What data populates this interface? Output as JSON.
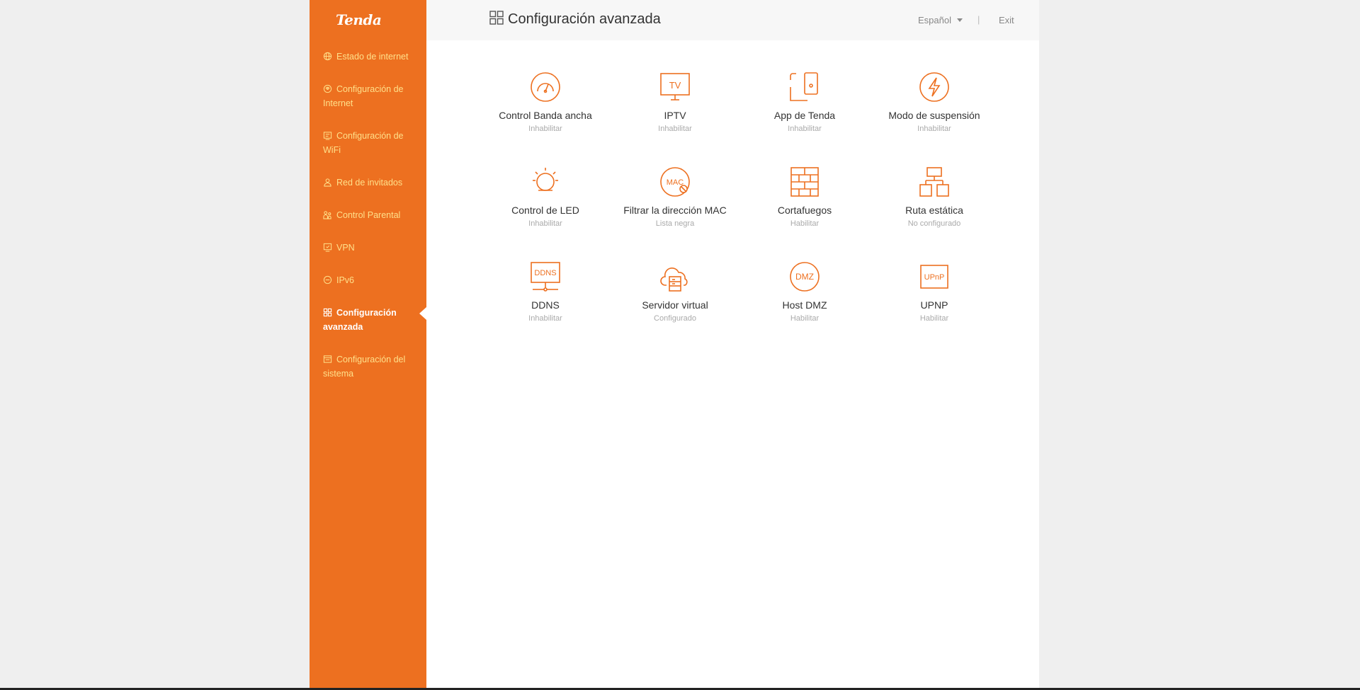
{
  "brand": {
    "logo_text": "Tenda",
    "accent": "#ed7020",
    "nav_text_color": "#ffe08a"
  },
  "sidebar": {
    "items": [
      {
        "label": "Estado de internet",
        "icon": "globe-icon"
      },
      {
        "label": "Configuración de Internet",
        "icon": "internet-settings-icon"
      },
      {
        "label": "Configuración de WiFi",
        "icon": "wifi-settings-icon"
      },
      {
        "label": "Red de invitados",
        "icon": "guest-icon"
      },
      {
        "label": "Control Parental",
        "icon": "parental-icon"
      },
      {
        "label": "VPN",
        "icon": "vpn-icon"
      },
      {
        "label": "IPv6",
        "icon": "ipv6-icon"
      },
      {
        "label": "Configuración avanzada",
        "icon": "grid-icon",
        "active": true
      },
      {
        "label": "Configuración del sistema",
        "icon": "system-icon"
      }
    ]
  },
  "header": {
    "title": "Configuración avanzada",
    "language": "Español",
    "separator": "|",
    "exit_label": "Exit"
  },
  "tiles": [
    {
      "name": "Control Banda ancha",
      "status": "Inhabilitar",
      "icon": "speedometer-icon"
    },
    {
      "name": "IPTV",
      "status": "Inhabilitar",
      "icon": "tv-icon",
      "icon_text": "TV"
    },
    {
      "name": "App de Tenda",
      "status": "Inhabilitar",
      "icon": "app-icon"
    },
    {
      "name": "Modo de suspensión",
      "status": "Inhabilitar",
      "icon": "lightning-icon"
    },
    {
      "name": "Control de LED",
      "status": "Inhabilitar",
      "icon": "led-icon"
    },
    {
      "name": "Filtrar la dirección MAC",
      "status": "Lista negra",
      "icon": "mac-filter-icon",
      "icon_text": "MAC"
    },
    {
      "name": "Cortafuegos",
      "status": "Habilitar",
      "icon": "firewall-icon"
    },
    {
      "name": "Ruta estática",
      "status": "No configurado",
      "icon": "static-route-icon"
    },
    {
      "name": "DDNS",
      "status": "Inhabilitar",
      "icon": "ddns-icon",
      "icon_text": "DDNS"
    },
    {
      "name": "Servidor virtual",
      "status": "Configurado",
      "icon": "cloud-server-icon"
    },
    {
      "name": "Host DMZ",
      "status": "Habilitar",
      "icon": "dmz-icon",
      "icon_text": "DMZ"
    },
    {
      "name": "UPNP",
      "status": "Habilitar",
      "icon": "upnp-icon",
      "icon_text": "UPnP"
    }
  ]
}
